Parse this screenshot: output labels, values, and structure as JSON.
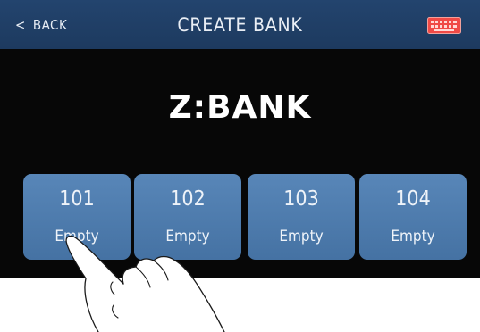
{
  "header": {
    "back_label": "BACK",
    "back_icon": "chevron-left-icon",
    "title": "CREATE BANK",
    "keyboard_icon": "keyboard-icon",
    "keyboard_icon_color": "#e0413d"
  },
  "bank_name": "Z:BANK",
  "slots": [
    {
      "number": "101",
      "status": "Empty"
    },
    {
      "number": "102",
      "status": "Empty"
    },
    {
      "number": "103",
      "status": "Empty"
    },
    {
      "number": "104",
      "status": "Empty"
    }
  ],
  "colors": {
    "header_bg": "#1f3d64",
    "screen_bg": "#070707",
    "slot_bg": "#4f7cae"
  }
}
